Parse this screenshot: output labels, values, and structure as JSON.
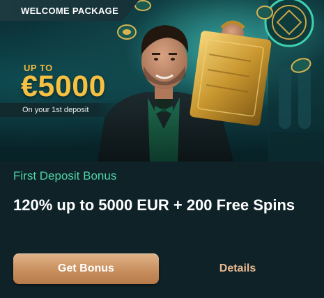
{
  "banner": {
    "tag": "WELCOME PACKAGE",
    "up_to": "UP TO",
    "amount": "€5000",
    "deposit_note": "On your 1st deposit"
  },
  "offer": {
    "subtitle": "First Deposit Bonus",
    "headline": "120% up to 5000 EUR + 200 Free Spins"
  },
  "actions": {
    "primary_label": "Get Bonus",
    "secondary_label": "Details"
  },
  "colors": {
    "background": "#0f2228",
    "accent_green": "#4fd4a6",
    "gold": "#f6c043",
    "button_bronze": "#c98f5e",
    "link_text": "#e9ba8f"
  }
}
